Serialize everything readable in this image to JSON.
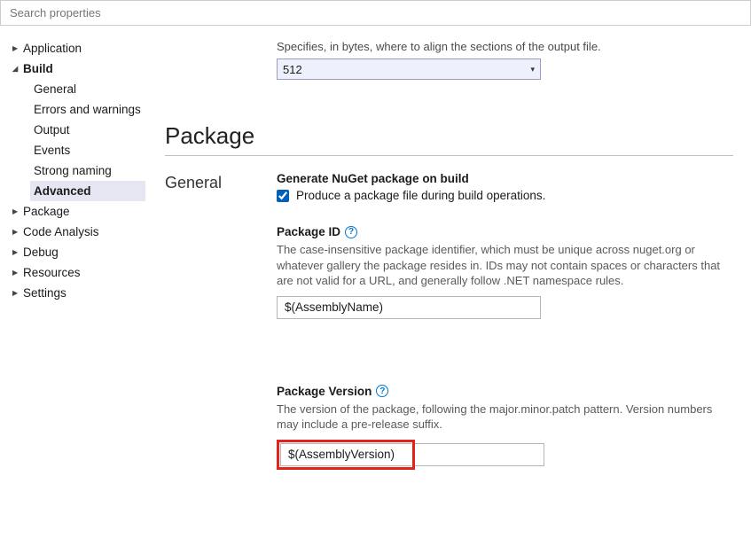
{
  "search": {
    "placeholder": "Search properties"
  },
  "sidebar": {
    "application": "Application",
    "build": "Build",
    "build_children": {
      "general": "General",
      "errors": "Errors and warnings",
      "output": "Output",
      "events": "Events",
      "strong": "Strong naming",
      "advanced": "Advanced"
    },
    "package": "Package",
    "code_analysis": "Code Analysis",
    "debug": "Debug",
    "resources": "Resources",
    "settings": "Settings"
  },
  "align": {
    "desc": "Specifies, in bytes, where to align the sections of the output file.",
    "value": "512"
  },
  "package_section": {
    "title": "Package",
    "subhead": "General",
    "gen_pkg": {
      "label": "Generate NuGet package on build",
      "checkbox_label": "Produce a package file during build operations."
    },
    "pkg_id": {
      "label": "Package ID",
      "desc": "The case-insensitive package identifier, which must be unique across nuget.org or whatever gallery the package resides in. IDs may not contain spaces or characters that are not valid for a URL, and generally follow .NET namespace rules.",
      "value": "$(AssemblyName)"
    },
    "pkg_ver": {
      "label": "Package Version",
      "desc": "The version of the package, following the major.minor.patch pattern. Version numbers may include a pre-release suffix.",
      "value": "$(AssemblyVersion)"
    }
  }
}
